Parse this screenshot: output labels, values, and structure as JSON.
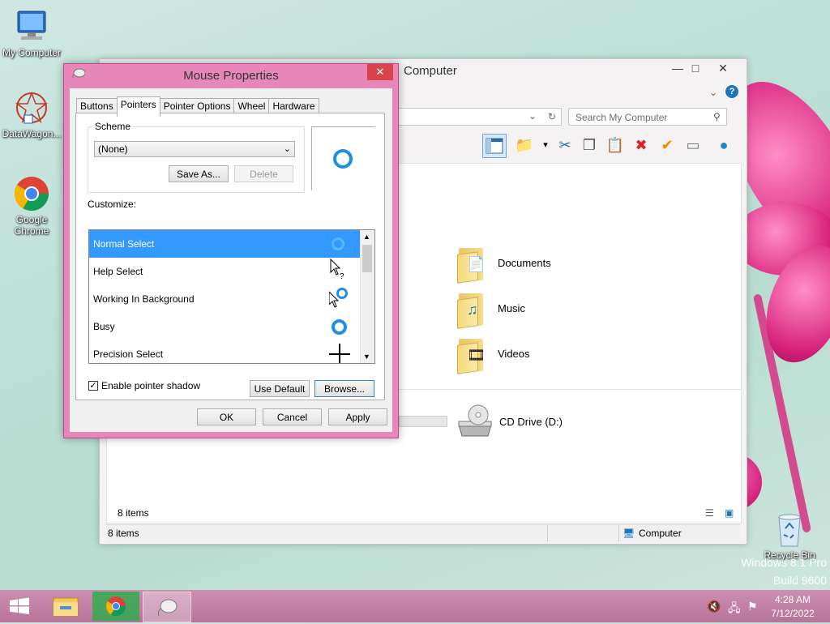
{
  "desktop": {
    "icons": [
      {
        "label": "My Computer"
      },
      {
        "label": "DataWagon..."
      },
      {
        "label": "Google Chrome"
      },
      {
        "label": "Recycle Bin"
      }
    ],
    "watermark": {
      "line1": "Windows 8.1 Pro",
      "line2": "Build 9600"
    }
  },
  "explorer": {
    "title": "Computer",
    "search_placeholder": "Search My Computer",
    "libraries": [
      {
        "name": "Documents",
        "icon": "documents-folder-icon"
      },
      {
        "name": "Music",
        "icon": "music-folder-icon"
      },
      {
        "name": "Videos",
        "icon": "videos-folder-icon"
      }
    ],
    "drive": {
      "name": "CD Drive (D:)"
    },
    "content_status": "8 items",
    "status_left": "8 items",
    "status_right": "Computer"
  },
  "dialog": {
    "title": "Mouse Properties",
    "close_label": "✕",
    "tabs": [
      "Buttons",
      "Pointers",
      "Pointer Options",
      "Wheel",
      "Hardware"
    ],
    "active_tab": "Pointers",
    "scheme_label": "Scheme",
    "scheme_value": "(None)",
    "save_as_label": "Save As...",
    "delete_label": "Delete",
    "customize_label": "Customize:",
    "pointers": [
      {
        "name": "Normal Select",
        "selected": true
      },
      {
        "name": "Help Select",
        "selected": false
      },
      {
        "name": "Working In Background",
        "selected": false
      },
      {
        "name": "Busy",
        "selected": false
      },
      {
        "name": "Precision Select",
        "selected": false
      }
    ],
    "shadow_label": "Enable pointer shadow",
    "shadow_checked": true,
    "use_default_label": "Use Default",
    "browse_label": "Browse...",
    "ok_label": "OK",
    "cancel_label": "Cancel",
    "apply_label": "Apply"
  },
  "taskbar": {
    "time": "4:28 AM",
    "date": "7/12/2022"
  },
  "colors": {
    "accent": "#3399ff",
    "dialog_frame": "#e786b9",
    "close_red": "#d7444a",
    "taskbar": "#c283a6"
  }
}
